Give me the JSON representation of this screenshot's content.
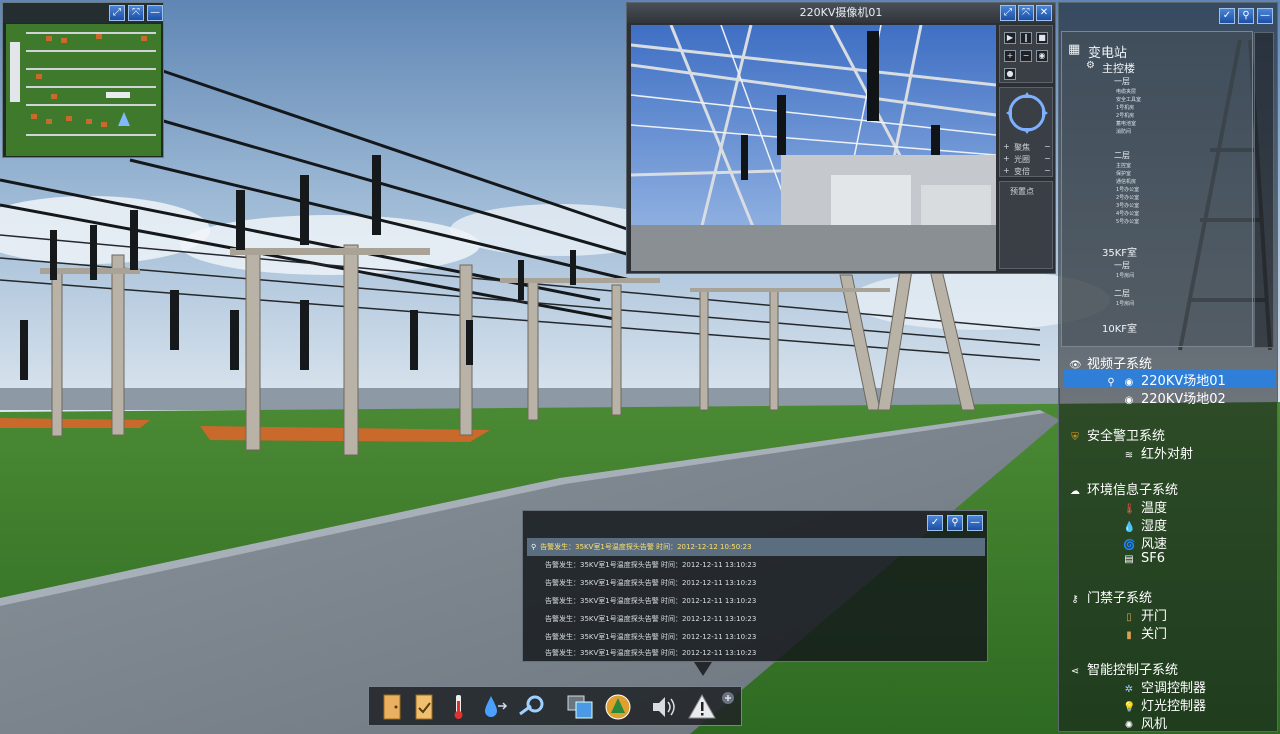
{
  "minimap": {
    "buttons": {
      "expand": "⤢",
      "fit": "⤧",
      "minimize": "—"
    }
  },
  "camera": {
    "title": "220KV摄像机01",
    "buttons": {
      "expand": "⤢",
      "fit": "⤧",
      "close": "✕"
    },
    "preset_label": "预置点",
    "zoom_labels": [
      "聚焦",
      "光圈",
      "变倍"
    ]
  },
  "right_panel": {
    "tree": {
      "root": "变电站",
      "building": "主控楼",
      "floor1": "一层",
      "floor1_rooms": [
        "电缆夹层",
        "安全工具室",
        "1号机房",
        "2号机房",
        "蓄电池室",
        "消防间"
      ],
      "floor2": "二层",
      "floor2_rooms": [
        "主控室",
        "保护室",
        "通信机房",
        "1号办公室",
        "2号办公室",
        "3号办公室",
        "4号办公室",
        "5号办公室"
      ],
      "room35": "35KF室",
      "room35_floor1": "一层",
      "room35_floor1_rooms": [
        "1号房间"
      ],
      "room35_floor2": "二层",
      "room35_floor2_rooms": [
        "1号房间"
      ],
      "room10": "10KF室"
    },
    "video": {
      "label": "视频子系统",
      "items": [
        "220KV场地01",
        "220KV场地02"
      ]
    },
    "security": {
      "label": "安全警卫系统",
      "items": [
        "红外对射"
      ]
    },
    "env": {
      "label": "环境信息子系统",
      "items": [
        "温度",
        "湿度",
        "风速",
        "SF6"
      ]
    },
    "access": {
      "label": "门禁子系统",
      "items": [
        "开门",
        "关门"
      ]
    },
    "control": {
      "label": "智能控制子系统",
      "items": [
        "空调控制器",
        "灯光控制器",
        "风机"
      ]
    }
  },
  "alarm": {
    "rows": [
      {
        "text": "告警发生：35KV室1号温度探头告警   时间：2012-12-12 10:50:23",
        "active": true
      },
      {
        "text": "告警发生：35KV室1号温度探头告警   时间：2012-12-11 13:10:23",
        "active": false
      },
      {
        "text": "告警发生：35KV室1号温度探头告警   时间：2012-12-11 13:10:23",
        "active": false
      },
      {
        "text": "告警发生：35KV室1号温度探头告警   时间：2012-12-11 13:10:23",
        "active": false
      },
      {
        "text": "告警发生：35KV室1号温度探头告警   时间：2012-12-11 13:10:23",
        "active": false
      },
      {
        "text": "告警发生：35KV室1号温度探头告警   时间：2012-12-11 13:10:23",
        "active": false
      },
      {
        "text": "告警发生：35KV室1号温度探头告警   时间：2012-12-11 13:10:23",
        "active": false
      }
    ]
  },
  "colors": {
    "accent": "#2f7fd8",
    "alarm_active": "#ffe066",
    "grass": "#3f7a2c"
  }
}
